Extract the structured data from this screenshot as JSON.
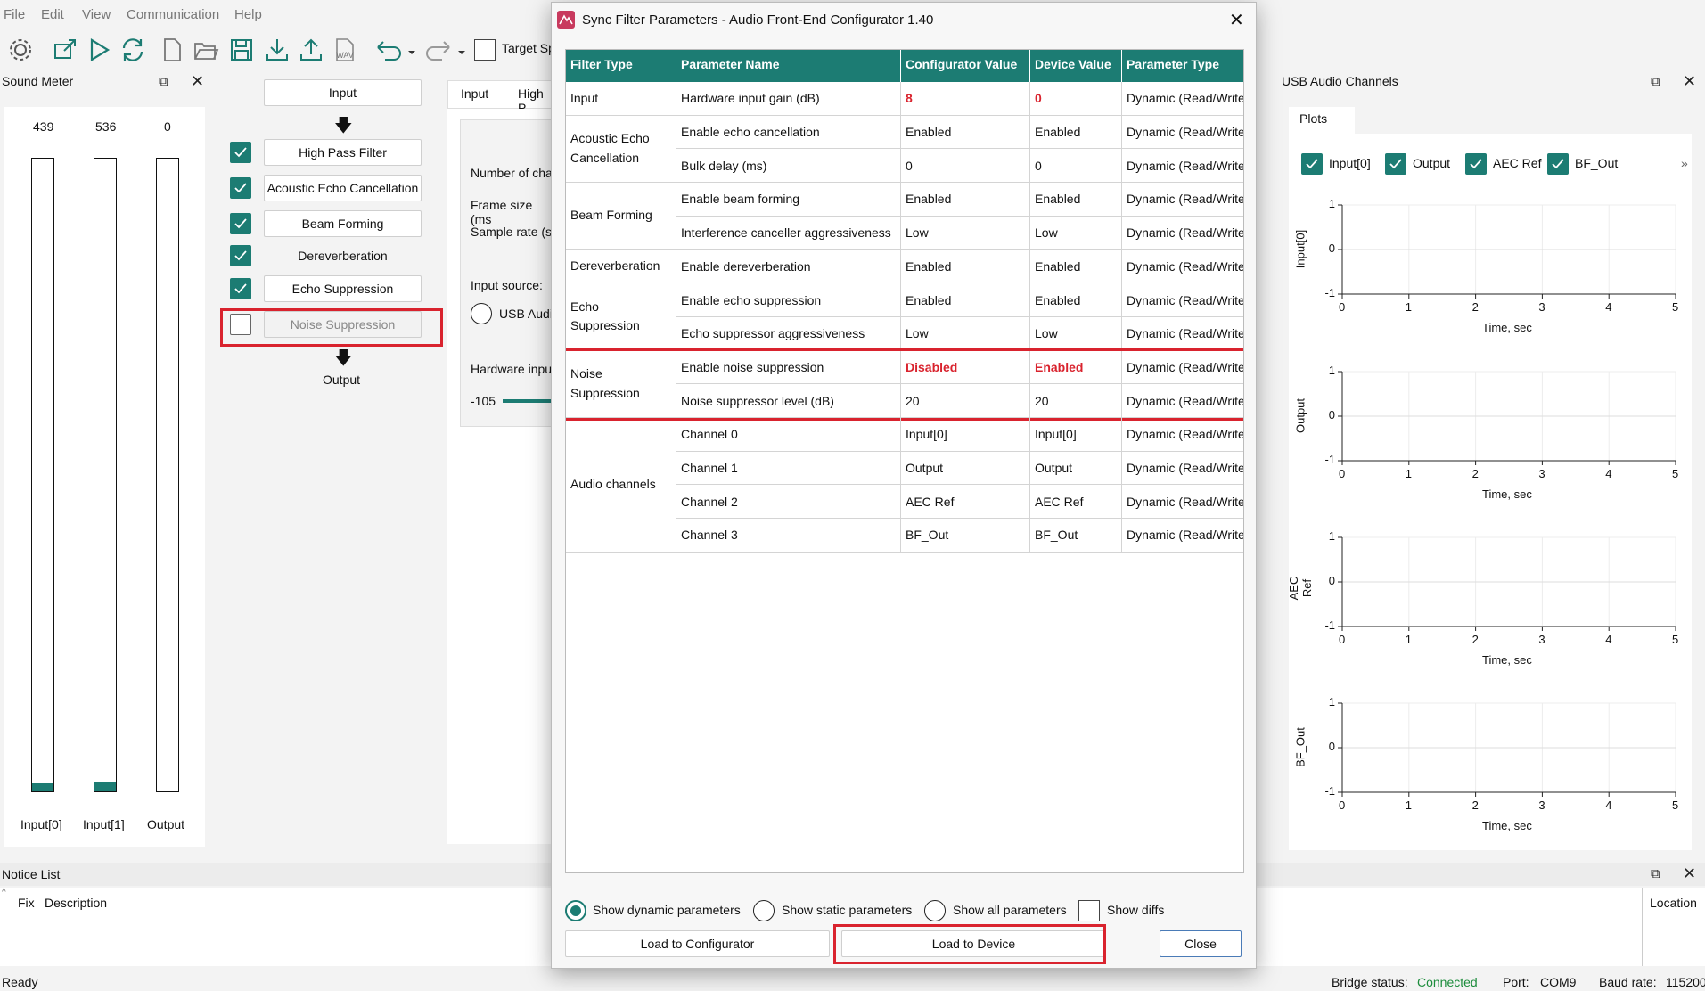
{
  "menu": [
    "File",
    "Edit",
    "View",
    "Communication",
    "Help"
  ],
  "toolbar": {
    "target_label": "Target Sp",
    "wav_label": "WAV"
  },
  "sound_meter": {
    "title": "Sound Meter",
    "values": [
      "439",
      "536",
      "0"
    ],
    "labels": [
      "Input[0]",
      "Input[1]",
      "Output"
    ],
    "levels": [
      0.012,
      0.014,
      0
    ]
  },
  "pipeline": {
    "input": "Input",
    "output": "Output",
    "stages": [
      {
        "label": "High Pass Filter",
        "enabled": true
      },
      {
        "label": "Acoustic Echo Cancellation",
        "enabled": true
      },
      {
        "label": "Beam Forming",
        "enabled": true
      },
      {
        "label": "Dereverberation",
        "enabled": true
      },
      {
        "label": "Echo Suppression",
        "enabled": true
      },
      {
        "label": "Noise Suppression",
        "enabled": false
      }
    ]
  },
  "middle": {
    "tabs": [
      "Input",
      "High P"
    ],
    "number_of_channels": "Number of cha",
    "frame_size": "Frame size (ms",
    "sample_rate": "Sample rate (s",
    "input_source": "Input source:",
    "usb_audio": "USB Audi",
    "hardware_input": "Hardware inpu",
    "slider_min": "-105"
  },
  "dialog": {
    "title": "Sync Filter Parameters - Audio Front-End Configurator 1.40",
    "columns": [
      "Filter Type",
      "Parameter Name",
      "Configurator Value",
      "Device Value",
      "Parameter Type"
    ],
    "groups": [
      {
        "type": "Input",
        "rows": [
          {
            "name": "Hardware input gain (dB)",
            "config": "8",
            "device": "0",
            "ptype": "Dynamic (Read/Write",
            "diff": true
          }
        ]
      },
      {
        "type": "Acoustic Echo Cancellation",
        "rows": [
          {
            "name": "Enable echo cancellation",
            "config": "Enabled",
            "device": "Enabled",
            "ptype": "Dynamic (Read/Write"
          },
          {
            "name": "Bulk delay (ms)",
            "config": "0",
            "device": "0",
            "ptype": "Dynamic (Read/Write"
          }
        ]
      },
      {
        "type": "Beam Forming",
        "rows": [
          {
            "name": "Enable beam forming",
            "config": "Enabled",
            "device": "Enabled",
            "ptype": "Dynamic (Read/Write"
          },
          {
            "name": "Interference canceller aggressiveness",
            "config": "Low",
            "device": "Low",
            "ptype": "Dynamic (Read/Write"
          }
        ]
      },
      {
        "type": "Dereverberation",
        "rows": [
          {
            "name": "Enable dereverberation",
            "config": "Enabled",
            "device": "Enabled",
            "ptype": "Dynamic (Read/Write"
          }
        ]
      },
      {
        "type": "Echo Suppression",
        "rows": [
          {
            "name": "Enable echo suppression",
            "config": "Enabled",
            "device": "Enabled",
            "ptype": "Dynamic (Read/Write"
          },
          {
            "name": "Echo suppressor aggressiveness",
            "config": "Low",
            "device": "Low",
            "ptype": "Dynamic (Read/Write"
          }
        ]
      },
      {
        "type": "Noise Suppression",
        "rows": [
          {
            "name": "Enable noise suppression",
            "config": "Disabled",
            "device": "Enabled",
            "ptype": "Dynamic (Read/Write",
            "diff": true
          },
          {
            "name": "Noise suppressor level (dB)",
            "config": "20",
            "device": "20",
            "ptype": "Dynamic (Read/Write"
          }
        ]
      },
      {
        "type": "Audio channels",
        "rows": [
          {
            "name": "Channel 0",
            "config": "Input[0]",
            "device": "Input[0]",
            "ptype": "Dynamic (Read/Write"
          },
          {
            "name": "Channel 1",
            "config": "Output",
            "device": "Output",
            "ptype": "Dynamic (Read/Write"
          },
          {
            "name": "Channel 2",
            "config": "AEC Ref",
            "device": "AEC Ref",
            "ptype": "Dynamic (Read/Write"
          },
          {
            "name": "Channel 3",
            "config": "BF_Out",
            "device": "BF_Out",
            "ptype": "Dynamic (Read/Write"
          }
        ]
      }
    ],
    "radios": [
      "Show dynamic parameters",
      "Show static parameters",
      "Show all parameters"
    ],
    "show_diffs": "Show diffs",
    "load_configurator": "Load to Configurator",
    "load_device": "Load to Device",
    "close": "Close"
  },
  "usb": {
    "title": "USB Audio Channels",
    "tab": "Plots",
    "channels": [
      "Input[0]",
      "Output",
      "AEC Ref",
      "BF_Out"
    ],
    "more": "»",
    "xlabel": "Time, sec",
    "xticks": [
      "0",
      "1",
      "2",
      "3",
      "4",
      "5"
    ],
    "yticks": [
      "1",
      "0",
      "-1"
    ]
  },
  "notice": {
    "title": "Notice List",
    "fix": "Fix",
    "description": "Description",
    "location": "Location"
  },
  "status": {
    "ready": "Ready",
    "bridge_label": "Bridge status:",
    "bridge_value": "Connected",
    "port_label": "Port:",
    "port_value": "COM9",
    "baud_label": "Baud rate:",
    "baud_value": "115200"
  },
  "colors": {
    "accent": "#1c7c73",
    "highlight": "#d9232e",
    "connected": "#1c8c3c"
  }
}
